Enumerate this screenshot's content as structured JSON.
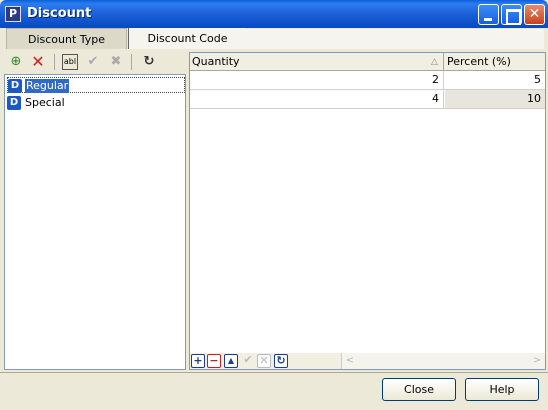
{
  "window": {
    "title": "Discount",
    "app_icon": "P"
  },
  "tabs": [
    {
      "label": "Discount Type"
    },
    {
      "label": "Discount Code"
    }
  ],
  "left_toolbar": {
    "icons": [
      "add-icon",
      "delete-icon",
      "rename-icon",
      "accept-icon",
      "cancel-icon",
      "refresh-icon"
    ],
    "rename_glyph": "abl"
  },
  "tree": {
    "items": [
      {
        "icon": "D",
        "label": "Regular",
        "selected": true
      },
      {
        "icon": "D",
        "label": "Special",
        "selected": false
      }
    ]
  },
  "grid": {
    "columns": [
      "Quantity",
      "Percent (%)"
    ],
    "rows": [
      {
        "quantity": "2",
        "percent": "5"
      },
      {
        "quantity": "4",
        "percent": "10"
      }
    ]
  },
  "grid_nav": [
    "add-row-icon",
    "remove-row-icon",
    "move-up-icon",
    "accept-icon",
    "cancel-icon",
    "refresh-icon"
  ],
  "buttons": {
    "close": "Close",
    "help": "Help"
  }
}
